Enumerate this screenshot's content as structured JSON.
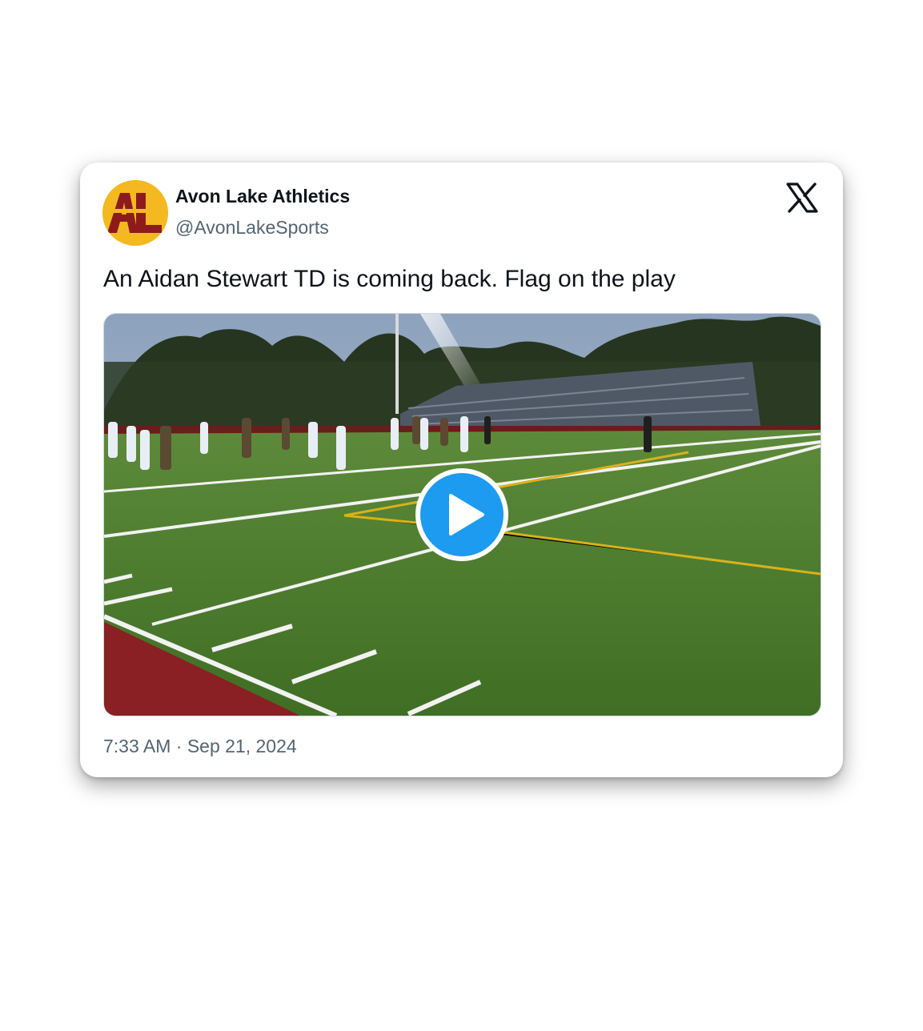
{
  "tweet": {
    "author_name": "Avon Lake Athletics",
    "author_handle": "@AvonLakeSports",
    "avatar_text": "AL",
    "text": "An Aidan Stewart TD is coming back. Flag on the play",
    "timestamp": "7:33 AM · Sep 21, 2024",
    "platform_icon": "x-logo-icon",
    "media": {
      "type": "video",
      "play_icon": "play-icon",
      "accent_color": "#1d9bf0"
    }
  },
  "colors": {
    "avatar_gold": "#f4b920",
    "avatar_maroon": "#8e1b1b",
    "text_primary": "#0f1419",
    "text_secondary": "#536471"
  }
}
